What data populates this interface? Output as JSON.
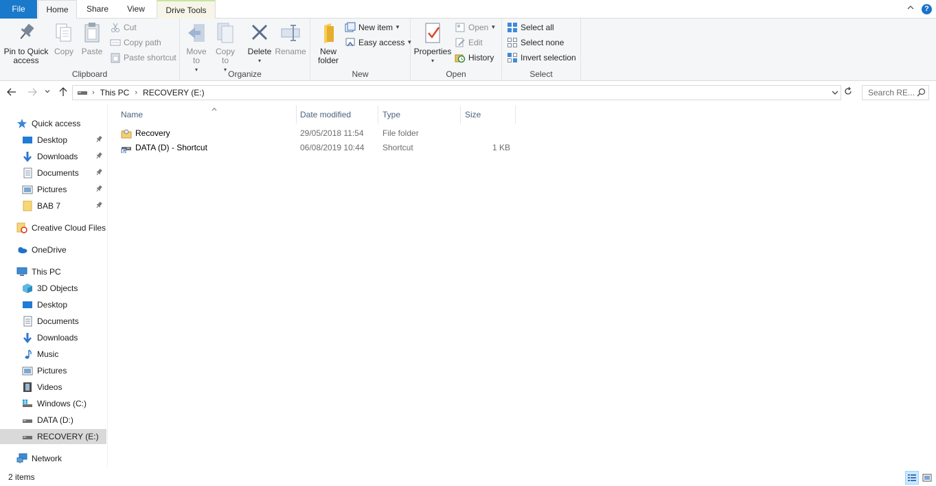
{
  "tabs": {
    "file": "File",
    "home": "Home",
    "share": "Share",
    "view": "View",
    "drive_tools": "Drive Tools"
  },
  "help_glyph": "?",
  "ribbon": {
    "clipboard": {
      "label": "Clipboard",
      "pin_to_quick_access": "Pin to Quick access",
      "copy": "Copy",
      "paste": "Paste",
      "cut": "Cut",
      "copy_path": "Copy path",
      "paste_shortcut": "Paste shortcut"
    },
    "organize": {
      "label": "Organize",
      "move_to": "Move to",
      "copy_to": "Copy to",
      "delete": "Delete",
      "rename": "Rename"
    },
    "new": {
      "label": "New",
      "new_folder": "New folder",
      "new_item": "New item",
      "easy_access": "Easy access"
    },
    "open": {
      "label": "Open",
      "properties": "Properties",
      "open": "Open",
      "edit": "Edit",
      "history": "History"
    },
    "select": {
      "label": "Select",
      "select_all": "Select all",
      "select_none": "Select none",
      "invert_selection": "Invert selection"
    }
  },
  "address": {
    "crumbs": [
      "This PC",
      "RECOVERY (E:)"
    ],
    "search_placeholder": "Search RE..."
  },
  "nav": {
    "quick_access": "Quick access",
    "quick_items": [
      {
        "label": "Desktop",
        "icon": "desktop-icon",
        "pinned": true
      },
      {
        "label": "Downloads",
        "icon": "downloads-icon",
        "pinned": true
      },
      {
        "label": "Documents",
        "icon": "documents-icon",
        "pinned": true
      },
      {
        "label": "Pictures",
        "icon": "pictures-icon",
        "pinned": true
      },
      {
        "label": "BAB 7",
        "icon": "folder-icon",
        "pinned": true
      }
    ],
    "creative_cloud": "Creative Cloud Files",
    "onedrive": "OneDrive",
    "this_pc": "This PC",
    "pc_items": [
      {
        "label": "3D Objects",
        "icon": "3d-objects-icon"
      },
      {
        "label": "Desktop",
        "icon": "desktop-icon"
      },
      {
        "label": "Documents",
        "icon": "documents-icon"
      },
      {
        "label": "Downloads",
        "icon": "downloads-icon"
      },
      {
        "label": "Music",
        "icon": "music-icon"
      },
      {
        "label": "Pictures",
        "icon": "pictures-icon"
      },
      {
        "label": "Videos",
        "icon": "videos-icon"
      },
      {
        "label": "Windows (C:)",
        "icon": "windows-drive-icon"
      },
      {
        "label": "DATA (D:)",
        "icon": "drive-icon"
      },
      {
        "label": "RECOVERY (E:)",
        "icon": "drive-icon",
        "selected": true
      }
    ],
    "network": "Network"
  },
  "columns": {
    "name": "Name",
    "date_modified": "Date modified",
    "type": "Type",
    "size": "Size"
  },
  "files": [
    {
      "name": "Recovery",
      "date": "29/05/2018 11:54",
      "type": "File folder",
      "size": "",
      "icon": "locked-folder-icon"
    },
    {
      "name": "DATA (D) - Shortcut",
      "date": "06/08/2019 10:44",
      "type": "Shortcut",
      "size": "1 KB",
      "icon": "drive-shortcut-icon"
    }
  ],
  "status": {
    "item_count": "2 items"
  },
  "colors": {
    "file_tab": "#1979ca",
    "ribbon_bg": "#f5f6f7",
    "selection": "#d9d9d9",
    "accent_blue": "#1a73c9"
  }
}
